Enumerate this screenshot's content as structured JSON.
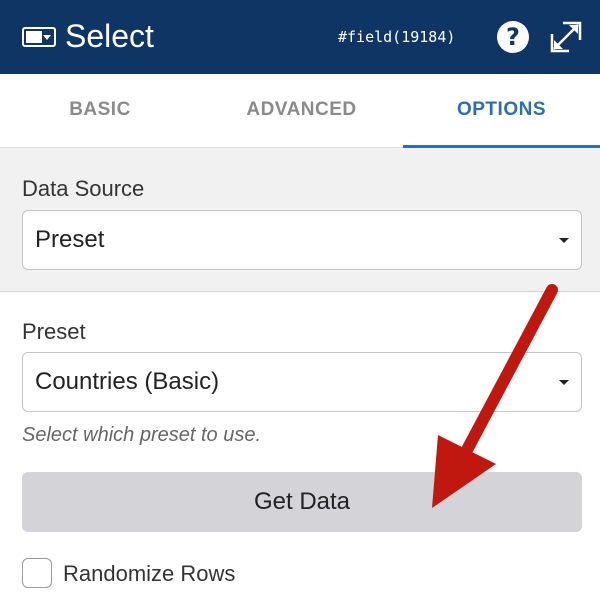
{
  "header": {
    "title": "Select",
    "field_id": "#field(19184)",
    "help_glyph": "?",
    "icons": [
      "select-glyph-icon",
      "help-icon",
      "expand-icon"
    ],
    "background_color": "#0f3564"
  },
  "tabs": [
    {
      "label": "BASIC",
      "active": false
    },
    {
      "label": "ADVANCED",
      "active": false
    },
    {
      "label": "OPTIONS",
      "active": true
    }
  ],
  "accent_color": "#2c6db5",
  "data_source": {
    "label": "Data Source",
    "value": "Preset"
  },
  "preset": {
    "label": "Preset",
    "value": "Countries (Basic)",
    "hint": "Select which preset to use."
  },
  "get_data_button": {
    "label": "Get Data"
  },
  "randomize_rows": {
    "label": "Randomize Rows",
    "checked": false
  },
  "annotation": {
    "type": "arrow",
    "color": "#c0180e",
    "points_to": "get-data-button"
  }
}
